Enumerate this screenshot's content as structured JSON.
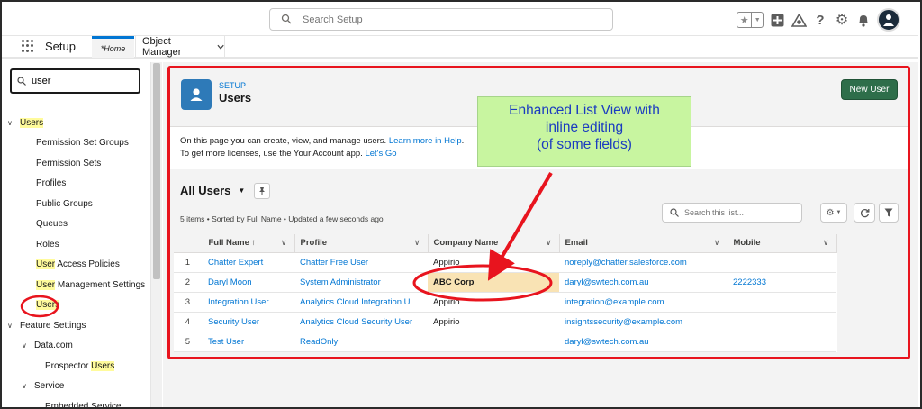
{
  "header": {
    "search_placeholder": "Search Setup",
    "icons": [
      "favorites-star-icon",
      "favorites-dropdown-icon",
      "global-actions-icon",
      "trailhead-icon",
      "help-icon",
      "setup-gear-icon",
      "notifications-bell-icon",
      "user-avatar"
    ]
  },
  "tabbar": {
    "app_name": "Setup",
    "home_tab": "*Home",
    "object_manager_tab": "Object Manager"
  },
  "sidebar": {
    "quick_find_value": "user",
    "tree": [
      {
        "label": "Users",
        "level": 0,
        "expanded": true,
        "highlight": "Users"
      },
      {
        "label": "Permission Set Groups",
        "level": 1
      },
      {
        "label": "Permission Sets",
        "level": 1
      },
      {
        "label": "Profiles",
        "level": 1
      },
      {
        "label": "Public Groups",
        "level": 1
      },
      {
        "label": "Queues",
        "level": 1
      },
      {
        "label": "Roles",
        "level": 1
      },
      {
        "label": "User Access Policies",
        "level": 1,
        "highlight": "User"
      },
      {
        "label": "User Management Settings",
        "level": 1,
        "highlight": "User"
      },
      {
        "label": "Users",
        "level": 1,
        "highlight": "Users",
        "selected": true
      },
      {
        "label": "Feature Settings",
        "level": 0,
        "expanded": true
      },
      {
        "label": "Data.com",
        "level": 1,
        "expanded": true
      },
      {
        "label": "Prospector Users",
        "level": 2,
        "highlight": "Users"
      },
      {
        "label": "Service",
        "level": 1,
        "expanded": true
      },
      {
        "label": "Embedded Service",
        "level": 2
      }
    ]
  },
  "page_header": {
    "kicker": "SETUP",
    "title": "Users",
    "new_button": "New User"
  },
  "intro": {
    "line1_text": "On this page you can create, view, and manage users. ",
    "line1_link": "Learn more in Help",
    "line1_end": ".",
    "line2_text": "To get more licenses, use the Your Account app. ",
    "line2_link": "Let's Go"
  },
  "list_view": {
    "title": "All Users",
    "meta": "5 items • Sorted by Full Name • Updated a few seconds ago",
    "search_placeholder": "Search this list...",
    "columns": [
      "",
      "Full Name ↑",
      "Profile",
      "Company Name",
      "Email",
      "Mobile"
    ],
    "rows": [
      {
        "n": "1",
        "name": "Chatter Expert",
        "profile": "Chatter Free User",
        "company": "Appirio",
        "email": "noreply@chatter.salesforce.com",
        "mobile": ""
      },
      {
        "n": "2",
        "name": "Daryl Moon",
        "profile": "System Administrator",
        "company": "ABC Corp",
        "email": "daryl@swtech.com.au",
        "mobile": "2222333",
        "edited": true
      },
      {
        "n": "3",
        "name": "Integration User",
        "profile": "Analytics Cloud Integration U...",
        "company": "Appirio",
        "email": "integration@example.com",
        "mobile": ""
      },
      {
        "n": "4",
        "name": "Security User",
        "profile": "Analytics Cloud Security User",
        "company": "Appirio",
        "email": "insightssecurity@example.com",
        "mobile": ""
      },
      {
        "n": "5",
        "name": "Test User",
        "profile": "ReadOnly",
        "company": "",
        "email": "daryl@swtech.com.au",
        "mobile": ""
      }
    ]
  },
  "annotation": {
    "callout_line1": "Enhanced List View with",
    "callout_line2": "inline editing",
    "callout_line3": "(of some fields)",
    "callout_color": "#1a3bc0",
    "callout_bg": "#c8f5a0",
    "highlight_color": "#e8141e"
  }
}
